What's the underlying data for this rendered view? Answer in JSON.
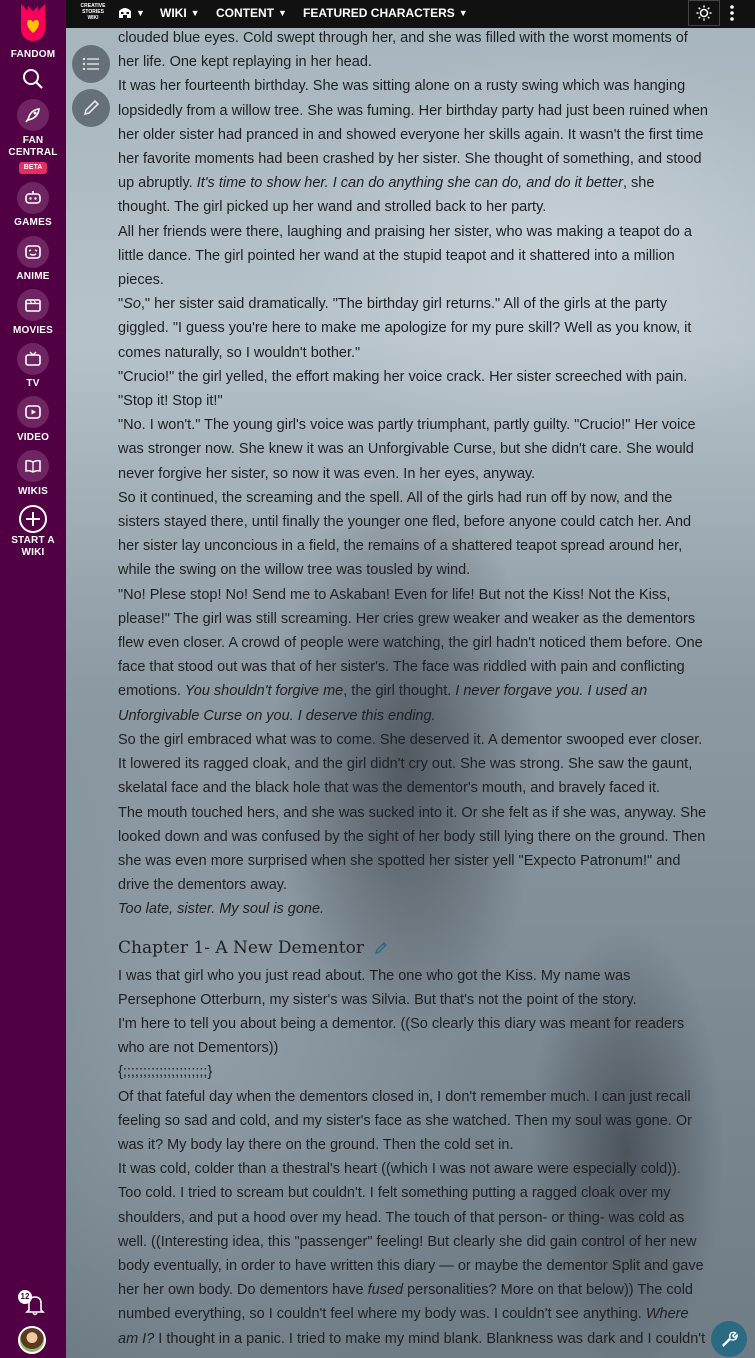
{
  "global_nav": {
    "brand": "FANDOM",
    "items": [
      {
        "label": "FAN CENTRAL",
        "icon": "rocket-icon",
        "badge": "BETA"
      },
      {
        "label": "GAMES",
        "icon": "gamepad-icon"
      },
      {
        "label": "ANIME",
        "icon": "anime-icon"
      },
      {
        "label": "MOVIES",
        "icon": "movie-icon"
      },
      {
        "label": "TV",
        "icon": "tv-icon"
      },
      {
        "label": "VIDEO",
        "icon": "video-icon"
      },
      {
        "label": "WIKIS",
        "icon": "book-icon"
      },
      {
        "label": "START A WIKI",
        "icon": "plus-circle-icon"
      }
    ],
    "notification_count": "12",
    "colors": {
      "background": "#520044",
      "beta": "#e62d61"
    }
  },
  "top_nav": {
    "wiki_logo": "CREATIVE STORIES WIKI",
    "items": [
      {
        "label": "",
        "icon": "community-icon"
      },
      {
        "label": "WIKI"
      },
      {
        "label": "CONTENT"
      },
      {
        "label": "FEATURED CHARACTERS"
      }
    ]
  },
  "article": {
    "p0": "clouded blue eyes. Cold swept through her, and she was filled with the worst moments of her life. One kept replaying in her head.",
    "p1a": "It was her fourteenth birthday. She was sitting alone on a rusty swing which was hanging lopsidedly from a willow tree. She was fuming. Her birthday party had just been ruined when her older sister had pranced in and showed everyone her skills again. It wasn't the first time her favorite moments had been crashed by her sister. She thought of something, and stood up abruptly. ",
    "p1b": "It's time to show her. I can do anything she can do, and do it better",
    "p1c": ", she thought. The girl picked up her wand and strolled back to her party.",
    "p2": "All her friends were there, laughing and praising her sister, who was making a teapot do a little dance. The girl pointed her wand at the stupid teapot and it shattered into a million pieces.",
    "p3a": "\"",
    "p3b": "So",
    "p3c": ",\" her sister said dramatically. \"The birthday girl returns.\" All of the girls at the party giggled. \"I guess you're here to make me apologize for my pure skill? Well as you know, it comes naturally, so I wouldn't bother.\"",
    "p4": "\"Crucio!\" the girl yelled, the effort making her voice crack. Her sister screeched with pain. \"Stop it! Stop it!\"",
    "p5": "\"No. I won't.\" The young girl's voice was partly triumphant, partly guilty. \"Crucio!\" Her voice was stronger now. She knew it was an Unforgivable Curse, but she didn't care. She would never forgive her sister, so now it was even. In her eyes, anyway.",
    "p6": "So it continued, the screaming and the spell. All of the girls had run off by now, and the sisters stayed there, until finally the younger one fled, before anyone could catch her. And her sister lay unconcious in a field, the remains of a shattered teapot spread around her, while the swing on the willow tree was tousled by wind.",
    "p7a": "\"No! Plese stop! No! Send me to Askaban! Even for life! But not the Kiss! Not the Kiss, please!\" The girl was still screaming. Her cries grew weaker and weaker as the dementors flew even closer. A crowd of people were watching, the girl hadn't noticed them before. One face that stood out was that of her sister's. The face was riddled with pain and conflicting emotions. ",
    "p7b": "You shouldn't forgive me",
    "p7c": ", the girl thought. ",
    "p7d": "I never forgave you. I used an Unforgivable Curse on you. I deserve this ending.",
    "p8": "So the girl embraced what was to come. She deserved it. A dementor swooped ever closer. It lowered its ragged cloak, and the girl didn't cry out. She was strong. She saw the gaunt, skelatal face and the black hole that was the dementor's mouth, and bravely faced it.",
    "p9": "The mouth touched hers, and she was sucked into it. Or she felt as if she was, anyway. She looked down and was confused by the sight of her body still lying there on the ground. Then she was even more surprised when she spotted her sister yell \"Expecto Patronum!\" and drive the dementors away.",
    "p10": "Too late, sister. My soul is gone.",
    "chapter_heading": "Chapter 1- A New Dementor",
    "c1": "I was that girl who you just read about. The one who got the Kiss. My name was Persephone Otterburn, my sister's was Silvia. But that's not the point of the story.",
    "c2": "I'm here to tell you about being a dementor. ((So clearly this diary was meant for readers who are not Dementors))",
    "c3": "{;;;;;;;;;;;;;;;;;;;;;}",
    "c4": "Of that fateful day when the dementors closed in, I don't remember much. I can just recall feeling so sad and cold, and my sister's face as she watched. Then my soul was gone. Or was it? My body lay there on the ground. Then the cold set in.",
    "c5a": "It was cold, colder than a thestral's heart ((which I was not aware were especially cold)). Too cold. I tried to scream but couldn't. I felt something putting a ragged cloak over my shoulders, and put a hood over my head. The touch of that person- or thing- was cold as well. ((Interesting idea, this \"passenger\" feeling! But clearly she did gain control of her new body eventually, in order to have written this diary — or maybe the dementor Split and gave her her own body. Do dementors have ",
    "c5b": "fused",
    "c5c": " personalities? More on that below)) The cold numbed everything, so I couldn't feel where my body was. I couldn't see anything. ",
    "c5d": "Where am I?",
    "c5e": " I thought in a panic. I tried to make my mind blank. Blankness was dark and I couldn't"
  }
}
